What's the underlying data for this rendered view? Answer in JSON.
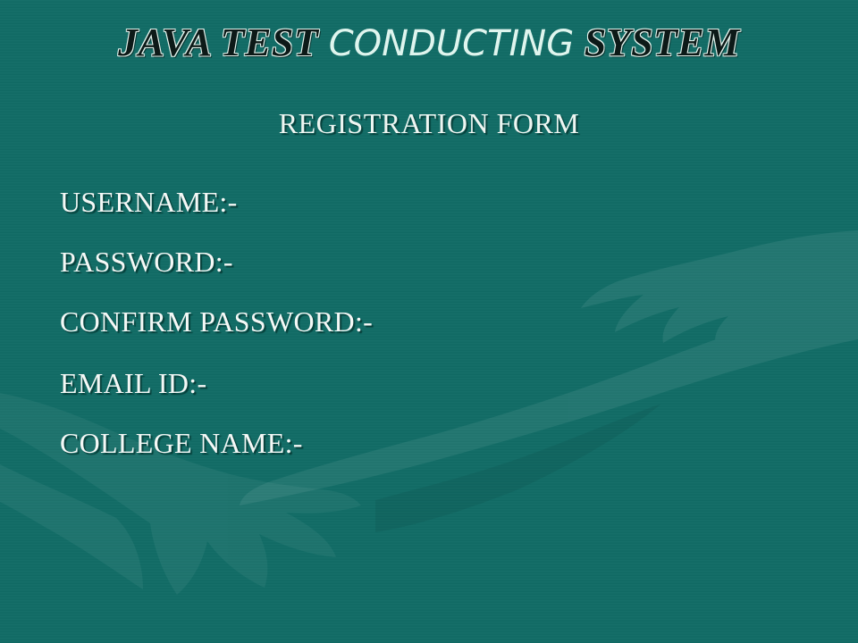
{
  "slide": {
    "background_color": "#116c66",
    "title": {
      "part1": "JAVA TEST",
      "part2": "CONDUCTING",
      "part3": "SYSTEM"
    },
    "subtitle": "REGISTRATION FORM",
    "fields": [
      {
        "label": "USERNAME:-"
      },
      {
        "label": "PASSWORD:-"
      },
      {
        "label": "CONFIRM PASSWORD:-"
      },
      {
        "label": "EMAIL ID:-"
      },
      {
        "label": "COLLEGE NAME:-"
      }
    ]
  }
}
